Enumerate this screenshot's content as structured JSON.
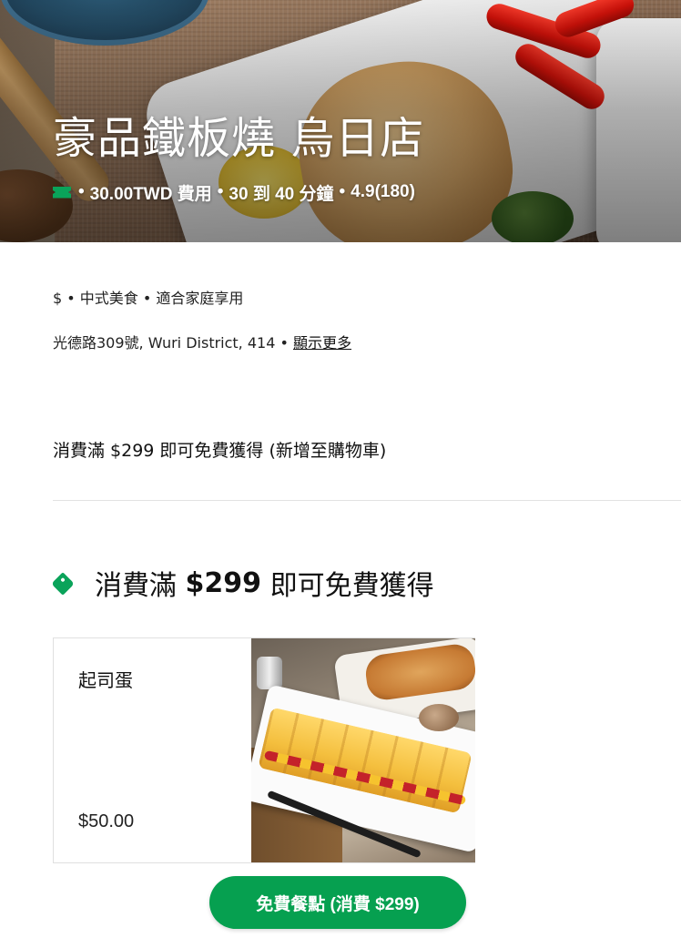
{
  "restaurant": {
    "name": "豪品鐵板燒 烏日店",
    "meta": {
      "fee": "30.00TWD 費用",
      "eta": "30 到 40 分鐘",
      "rating": "4.9(180)",
      "separator": "•"
    },
    "categories": "$ • 中式美食 • 適合家庭享用",
    "address": "光德路309號, Wuri District, 414 •",
    "show_more_label": "顯示更多"
  },
  "promo_banner": "消費滿 $299 即可免費獲得 (新增至購物車)",
  "section": {
    "prefix": "消費滿",
    "amount": "$299",
    "suffix": "即可免費獲得"
  },
  "items": [
    {
      "name": "起司蛋",
      "price": "$50.00"
    }
  ],
  "cta": {
    "label": "免費餐點 (消費 $299)"
  },
  "colors": {
    "accent_green": "#06a050",
    "tag_green": "#0aa35a"
  },
  "icons": [
    "ticket-icon",
    "tag-icon"
  ]
}
